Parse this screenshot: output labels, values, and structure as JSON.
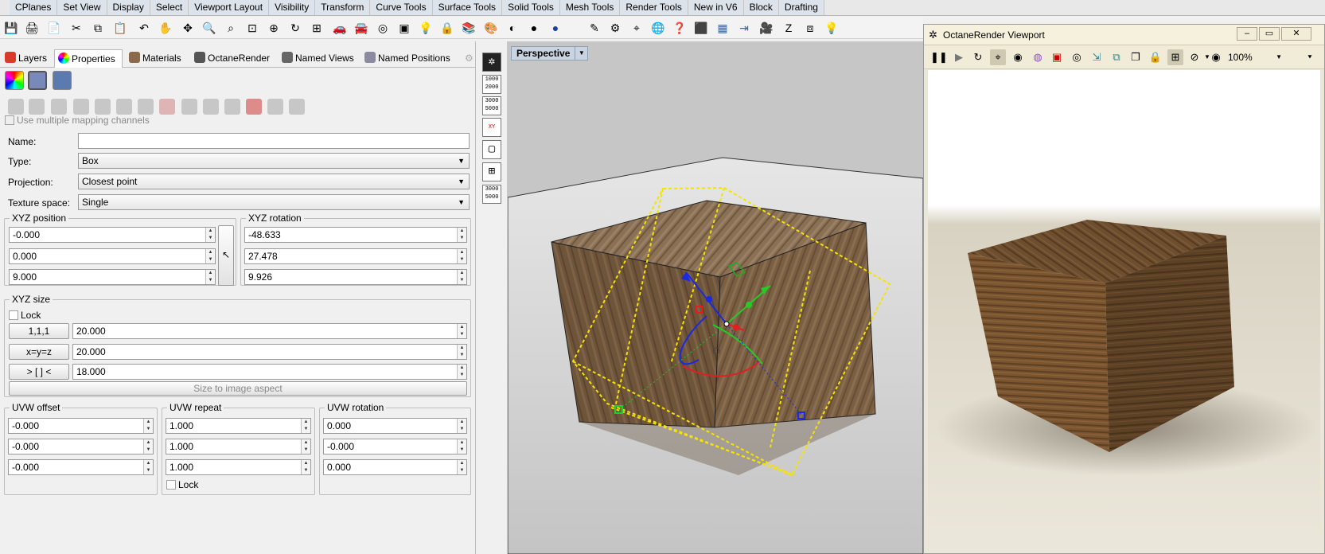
{
  "tabs": [
    "CPlanes",
    "Set View",
    "Display",
    "Select",
    "Viewport Layout",
    "Visibility",
    "Transform",
    "Curve Tools",
    "Surface Tools",
    "Solid Tools",
    "Mesh Tools",
    "Render Tools",
    "New in V6",
    "Block",
    "Drafting"
  ],
  "toolbar_icons": [
    "save-icon",
    "print-icon",
    "new-file-icon",
    "cut-icon",
    "copy-icon",
    "paste-icon",
    "undo-icon",
    "pan-hand-icon",
    "rotate-view-icon",
    "zoom-icon",
    "zoom-window-icon",
    "zoom-selected-icon",
    "zoom-extents-icon",
    "viewport-layout-icon",
    "car-icon",
    "car-icon",
    "cplane-icon",
    "layer-icon",
    "light-icon",
    "lock-icon",
    "layers-icon",
    "color-wheel-icon",
    "material-sphere-icon",
    "shaded-sphere-icon",
    "render-sphere-icon",
    "pencil-icon",
    "gear-icon",
    "osnap-icon",
    "globe-icon",
    "help-icon",
    "cube-icon",
    "box-icon",
    "extrude-icon",
    "camera-icon",
    "z-icon",
    "frame-icon",
    "bulb-icon"
  ],
  "panel": {
    "tabs": [
      "Layers",
      "Properties",
      "Materials",
      "OctaneRender",
      "Named Views",
      "Named Positions"
    ],
    "use_multiple_mapping": "Use multiple mapping channels",
    "name_label": "Name:",
    "name_value": "",
    "type_label": "Type:",
    "type_value": "Box",
    "projection_label": "Projection:",
    "projection_value": "Closest point",
    "texture_space_label": "Texture space:",
    "texture_space_value": "Single",
    "xyz_position": {
      "title": "XYZ position",
      "x": "-0.000",
      "y": "0.000",
      "z": "9.000"
    },
    "xyz_rotation": {
      "title": "XYZ rotation",
      "x": "-48.633",
      "y": "27.478",
      "z": "9.926"
    },
    "xyz_size": {
      "title": "XYZ size",
      "lock": "Lock",
      "btn_111": "1,1,1",
      "btn_xyz": "x=y=z",
      "btn_fit": "> [ ] <",
      "x": "20.000",
      "y": "20.000",
      "z": "18.000",
      "size_to_image": "Size to image aspect"
    },
    "uvw_offset": {
      "title": "UVW offset",
      "u": "-0.000",
      "v": "-0.000",
      "w": "-0.000"
    },
    "uvw_repeat": {
      "title": "UVW repeat",
      "u": "1.000",
      "v": "1.000",
      "w": "1.000",
      "lock": "Lock"
    },
    "uvw_rotation": {
      "title": "UVW rotation",
      "u": "0.000",
      "v": "-0.000",
      "w": "0.000"
    }
  },
  "strip": {
    "icons": [
      "octane-icon",
      "resolution-1000-2000-icon",
      "resolution-3000-5000-icon",
      "xy-icon",
      "single-view-icon",
      "quad-view-icon",
      "resolution-3000-5000-icon"
    ],
    "res1_line1": "1000",
    "res1_line2": "2000",
    "res2_line1": "3000",
    "res2_line2": "5000",
    "xy": "XY"
  },
  "viewport": {
    "label": "Perspective"
  },
  "octane": {
    "title": "OctaneRender Viewport",
    "zoom": "100%",
    "toolbar_icons": [
      "pause-icon",
      "play-icon",
      "restart-icon",
      "focus-picker-icon",
      "material-picker-icon",
      "color-picker-icon",
      "region-icon",
      "camera-icon",
      "export-icon",
      "clipboard-icon",
      "copy-icon",
      "lock-icon",
      "grid-icon",
      "viewport-resolution-icon",
      "eye-icon"
    ]
  },
  "colors": {
    "accent": "#c9d4e0",
    "wood": "#7a5a3a",
    "gizmo_yellow": "#f5e400"
  }
}
